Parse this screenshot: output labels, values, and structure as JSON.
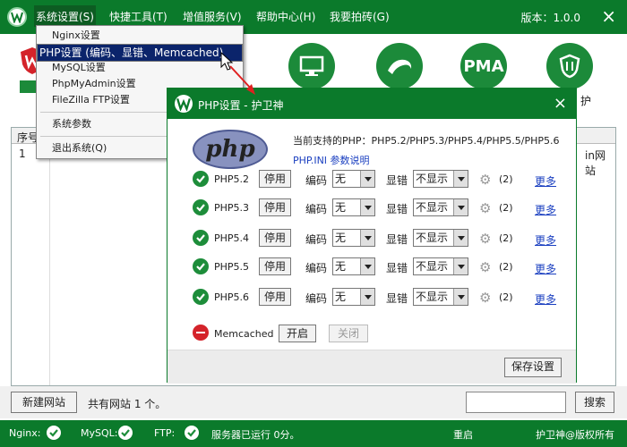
{
  "menubar": {
    "items": [
      "系统设置(S)",
      "快捷工具(T)",
      "增值服务(V)",
      "帮助中心(H)",
      "我要拍砖(G)"
    ],
    "version": "版本：1.0.0"
  },
  "toolbar": {
    "icons": [
      "monitor-icon",
      "mysql-dolphin-icon",
      "pma-icon",
      "shield-icon"
    ],
    "pma_text": "PMA",
    "partial_label": "护"
  },
  "dropdown": {
    "items": [
      "Nginx设置",
      "PHP设置 (编码、显错、Memcached)",
      "MySQL设置",
      "PhpMyAdmin设置",
      "FileZilla FTP设置",
      "系统参数",
      "退出系统(Q)"
    ],
    "selected_index": 1
  },
  "site_table": {
    "header_first": "序号",
    "row1_num": "1",
    "row1_tail": "in网站"
  },
  "dialog": {
    "title": "PHP设置 - 护卫神",
    "supported": "当前支持的PHP：PHP5.2/PHP5.3/PHP5.4/PHP5.5/PHP5.6",
    "ini_link": "PHP.INI 参数说明",
    "rows": [
      {
        "version": "PHP5.2",
        "stop": "停用",
        "enc_label": "编码",
        "enc": "无",
        "err_label": "显错",
        "err": "不显示",
        "count": "(2)",
        "more": "更多"
      },
      {
        "version": "PHP5.3",
        "stop": "停用",
        "enc_label": "编码",
        "enc": "无",
        "err_label": "显错",
        "err": "不显示",
        "count": "(2)",
        "more": "更多"
      },
      {
        "version": "PHP5.4",
        "stop": "停用",
        "enc_label": "编码",
        "enc": "无",
        "err_label": "显错",
        "err": "不显示",
        "count": "(2)",
        "more": "更多"
      },
      {
        "version": "PHP5.5",
        "stop": "停用",
        "enc_label": "编码",
        "enc": "无",
        "err_label": "显错",
        "err": "不显示",
        "count": "(2)",
        "more": "更多"
      },
      {
        "version": "PHP5.6",
        "stop": "停用",
        "enc_label": "编码",
        "enc": "无",
        "err_label": "显错",
        "err": "不显示",
        "count": "(2)",
        "more": "更多"
      }
    ],
    "memcached": {
      "label": "Memcached",
      "start": "开启",
      "close": "关闭"
    },
    "save": "保存设置"
  },
  "bottom": {
    "new_site": "新建网站",
    "site_count": "共有网站 1 个。",
    "search_value": "",
    "search": "搜索"
  },
  "status": {
    "nginx": "Nginx:",
    "mysql": "MySQL:",
    "ftp": "FTP:",
    "uptime": "服务器已运行 0分。",
    "restart": "重启",
    "copyright": "护卫神@版权所有"
  },
  "colors": {
    "brand_green": "#0b7a2b",
    "menu_select": "#0b246b",
    "link_blue": "#1a3fc0",
    "stop_red": "#d4232a"
  }
}
